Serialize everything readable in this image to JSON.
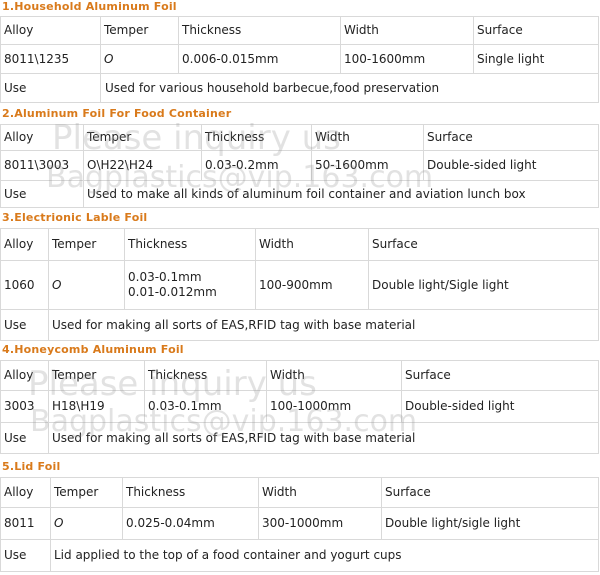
{
  "sections": [
    {
      "title": "1.Household Aluminum Foil",
      "header": {
        "alloy": "Alloy",
        "temper": "Temper",
        "thickness": "Thickness",
        "width": "Width",
        "surface": "Surface"
      },
      "row": {
        "alloy": "8011\\1235",
        "temper": "O",
        "thickness": "0.006-0.015mm",
        "width": "100-1600mm",
        "surface": "Single light"
      },
      "use": {
        "label": "Use",
        "text": "Used for various household barbecue,food preservation"
      }
    },
    {
      "title": "2.Aluminum Foil For Food Container",
      "header": {
        "alloy": "Alloy",
        "temper": "Temper",
        "thickness": "Thickness",
        "width": "Width",
        "surface": "Surface"
      },
      "row": {
        "alloy": "8011\\3003",
        "temper": "O\\H22\\H24",
        "thickness": "0.03-0.2mm",
        "width": "50-1600mm",
        "surface": "Double-sided light"
      },
      "use": {
        "label": "Use",
        "text": "Used to make all kinds of aluminum foil container and aviation lunch box"
      }
    },
    {
      "title": "3.Electrionic Lable Foil",
      "header": {
        "alloy": "Alloy",
        "temper": "Temper",
        "thickness": "Thickness",
        "width": "Width",
        "surface": "Surface"
      },
      "row": {
        "alloy": "1060",
        "temper": "O",
        "thickness_1": "0.03-0.1mm",
        "thickness_2": "0.01-0.012mm",
        "width": "100-900mm",
        "surface": "Double light/Sigle light"
      },
      "use": {
        "label": "Use",
        "text": "Used for making all sorts of EAS,RFID tag with base material"
      }
    },
    {
      "title": "4.Honeycomb Aluminum Foil",
      "header": {
        "alloy": "Alloy",
        "temper": "Temper",
        "thickness": "Thickness",
        "width": "Width",
        "surface": "Surface"
      },
      "row": {
        "alloy": "3003",
        "temper": "H18\\H19",
        "thickness": "0.03-0.1mm",
        "width": "100-1000mm",
        "surface": "Double-sided light"
      },
      "use": {
        "label": "Use",
        "text": "Used for making all sorts of EAS,RFID tag with base material"
      }
    },
    {
      "title": "5.Lid Foil",
      "header": {
        "alloy": "Alloy",
        "temper": "Temper",
        "thickness": "Thickness",
        "width": "Width",
        "surface": "Surface"
      },
      "row": {
        "alloy": "8011",
        "temper": "O",
        "thickness": "0.025-0.04mm",
        "width": "300-1000mm",
        "surface": "Double light/sigle light"
      },
      "use": {
        "label": "Use",
        "text": "Lid applied to the top of a food container and yogurt cups"
      }
    }
  ],
  "watermarks": [
    "Please inquiry us",
    "Bagplastics@vip.163.com",
    "Please inquiry us",
    "Bagplastics@vip.163.com"
  ]
}
